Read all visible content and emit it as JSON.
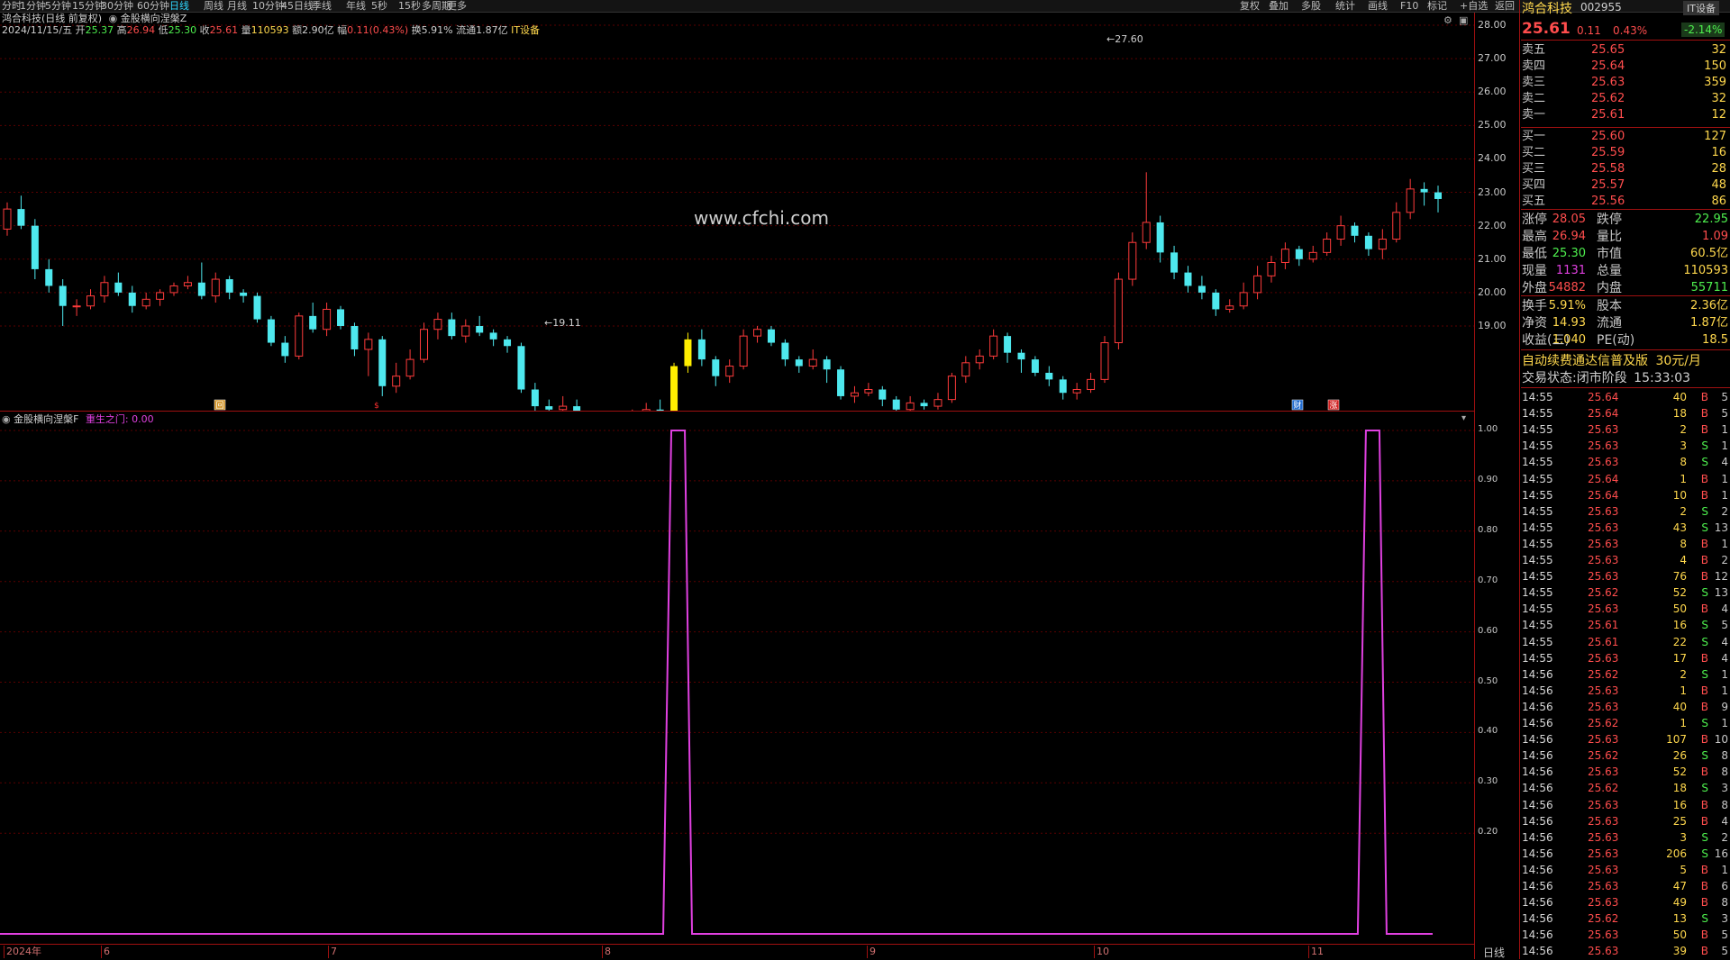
{
  "toolbar": {
    "periods": [
      "分时",
      "1分钟",
      "5分钟",
      "15分钟",
      "30分钟",
      "60分钟",
      "日线",
      "周线",
      "月线",
      "10分钟",
      "45日线",
      "季线",
      "年线",
      "5秒",
      "15秒",
      "多周期",
      "更多"
    ],
    "active_period": "日线",
    "right_items": [
      "复权",
      "叠加",
      "多股",
      "统计",
      "画线",
      "F10",
      "标记",
      "+自选",
      "返回"
    ]
  },
  "chart": {
    "stock_line": "鸿合科技(日线 前复权)",
    "formula_name": "金股横向涅槃Z",
    "info": {
      "date": "2024/11/15/五",
      "open_label": "开",
      "open": "25.37",
      "high_label": "高",
      "high": "26.94",
      "low_label": "低",
      "low": "25.30",
      "close_label": "收",
      "close": "25.61",
      "vol_label": "量",
      "vol": "110593",
      "amount_label": "额",
      "amount": "2.90亿",
      "change_label": "幅",
      "change": "0.11(0.43%)",
      "turnover": "换5.91%",
      "float": "流通1.87亿",
      "sector": "IT设备"
    },
    "y_labels": [
      "28.00",
      "27.00",
      "26.00",
      "25.00",
      "24.00",
      "23.00",
      "22.00",
      "21.00",
      "20.00",
      "19.00"
    ],
    "max_label": "27.60",
    "min_label": "19.11",
    "watermark": "www.cfchi.com",
    "markers": [
      "回",
      "$",
      "财",
      "涨"
    ]
  },
  "indicator": {
    "name": "金股横向涅槃F",
    "line_label": "重生之门:",
    "line_value": "0.00",
    "y_labels": [
      "1.00",
      "0.90",
      "0.80",
      "0.70",
      "0.60",
      "0.50",
      "0.40",
      "0.30",
      "0.20"
    ]
  },
  "x_axis": [
    "2024年",
    "6",
    "7",
    "8",
    "9",
    "10",
    "11"
  ],
  "bottom_label": "日线",
  "panel": {
    "name": "鸿合科技",
    "code": "002955",
    "sector": "IT设备",
    "price": "25.61",
    "change": "0.11",
    "pct": "0.43%",
    "sector_pct": "-2.14%",
    "asks": [
      {
        "label": "卖五",
        "price": "25.65",
        "vol": "32"
      },
      {
        "label": "卖四",
        "price": "25.64",
        "vol": "150"
      },
      {
        "label": "卖三",
        "price": "25.63",
        "vol": "359"
      },
      {
        "label": "卖二",
        "price": "25.62",
        "vol": "32"
      },
      {
        "label": "卖一",
        "price": "25.61",
        "vol": "12"
      }
    ],
    "bids": [
      {
        "label": "买一",
        "price": "25.60",
        "vol": "127"
      },
      {
        "label": "买二",
        "price": "25.59",
        "vol": "16"
      },
      {
        "label": "买三",
        "price": "25.58",
        "vol": "28"
      },
      {
        "label": "买四",
        "price": "25.57",
        "vol": "48"
      },
      {
        "label": "买五",
        "price": "25.56",
        "vol": "86"
      }
    ],
    "stats": [
      {
        "l1": "涨停",
        "v1": "28.05",
        "l2": "跌停",
        "v2": "22.95"
      },
      {
        "l1": "最高",
        "v1": "26.94",
        "l2": "量比",
        "v2": "1.09"
      },
      {
        "l1": "最低",
        "v1": "25.30",
        "l2": "市值",
        "v2": "60.5亿"
      },
      {
        "l1": "现量",
        "v1": "1131",
        "l2": "总量",
        "v2": "110593"
      },
      {
        "l1": "外盘",
        "v1": "54882",
        "l2": "内盘",
        "v2": "55711"
      }
    ],
    "stats2": [
      {
        "l1": "换手",
        "v1": "5.91%",
        "l2": "股本",
        "v2": "2.36亿"
      },
      {
        "l1": "净资",
        "v1": "14.93",
        "l2": "流通",
        "v2": "1.87亿"
      },
      {
        "l1": "收益(三)",
        "v1": "1.040",
        "l2": "PE(动)",
        "v2": "18.5"
      }
    ],
    "ad": "自动续费通达信普及版",
    "ad_price": "30元/月",
    "trade_status_label": "交易状态:",
    "trade_status": "闭市阶段",
    "trade_time": "15:33:03",
    "ticks": [
      {
        "t": "14:55",
        "p": "25.64",
        "v": "40",
        "d": "B",
        "n": "5"
      },
      {
        "t": "14:55",
        "p": "25.64",
        "v": "18",
        "d": "B",
        "n": "5"
      },
      {
        "t": "14:55",
        "p": "25.63",
        "v": "2",
        "d": "B",
        "n": "1"
      },
      {
        "t": "14:55",
        "p": "25.63",
        "v": "3",
        "d": "S",
        "n": "1"
      },
      {
        "t": "14:55",
        "p": "25.63",
        "v": "8",
        "d": "S",
        "n": "4"
      },
      {
        "t": "14:55",
        "p": "25.64",
        "v": "1",
        "d": "B",
        "n": "1"
      },
      {
        "t": "14:55",
        "p": "25.64",
        "v": "10",
        "d": "B",
        "n": "1"
      },
      {
        "t": "14:55",
        "p": "25.63",
        "v": "2",
        "d": "S",
        "n": "2"
      },
      {
        "t": "14:55",
        "p": "25.63",
        "v": "43",
        "d": "S",
        "n": "13"
      },
      {
        "t": "14:55",
        "p": "25.63",
        "v": "8",
        "d": "B",
        "n": "1"
      },
      {
        "t": "14:55",
        "p": "25.63",
        "v": "4",
        "d": "B",
        "n": "2"
      },
      {
        "t": "14:55",
        "p": "25.63",
        "v": "76",
        "d": "B",
        "n": "12"
      },
      {
        "t": "14:55",
        "p": "25.62",
        "v": "52",
        "d": "S",
        "n": "13"
      },
      {
        "t": "14:55",
        "p": "25.63",
        "v": "50",
        "d": "B",
        "n": "4"
      },
      {
        "t": "14:55",
        "p": "25.61",
        "v": "16",
        "d": "S",
        "n": "5"
      },
      {
        "t": "14:55",
        "p": "25.61",
        "v": "22",
        "d": "S",
        "n": "4"
      },
      {
        "t": "14:55",
        "p": "25.63",
        "v": "17",
        "d": "B",
        "n": "4"
      },
      {
        "t": "14:56",
        "p": "25.62",
        "v": "2",
        "d": "S",
        "n": "1"
      },
      {
        "t": "14:56",
        "p": "25.63",
        "v": "1",
        "d": "B",
        "n": "1"
      },
      {
        "t": "14:56",
        "p": "25.63",
        "v": "40",
        "d": "B",
        "n": "9"
      },
      {
        "t": "14:56",
        "p": "25.62",
        "v": "1",
        "d": "S",
        "n": "1"
      },
      {
        "t": "14:56",
        "p": "25.63",
        "v": "107",
        "d": "B",
        "n": "10"
      },
      {
        "t": "14:56",
        "p": "25.62",
        "v": "26",
        "d": "S",
        "n": "8"
      },
      {
        "t": "14:56",
        "p": "25.63",
        "v": "52",
        "d": "B",
        "n": "8"
      },
      {
        "t": "14:56",
        "p": "25.62",
        "v": "18",
        "d": "S",
        "n": "3"
      },
      {
        "t": "14:56",
        "p": "25.63",
        "v": "16",
        "d": "B",
        "n": "8"
      },
      {
        "t": "14:56",
        "p": "25.63",
        "v": "25",
        "d": "B",
        "n": "4"
      },
      {
        "t": "14:56",
        "p": "25.63",
        "v": "3",
        "d": "S",
        "n": "2"
      },
      {
        "t": "14:56",
        "p": "25.63",
        "v": "206",
        "d": "S",
        "n": "16"
      },
      {
        "t": "14:56",
        "p": "25.63",
        "v": "5",
        "d": "B",
        "n": "1"
      },
      {
        "t": "14:56",
        "p": "25.63",
        "v": "47",
        "d": "B",
        "n": "6"
      },
      {
        "t": "14:56",
        "p": "25.63",
        "v": "49",
        "d": "B",
        "n": "8"
      },
      {
        "t": "14:56",
        "p": "25.62",
        "v": "13",
        "d": "S",
        "n": "3"
      },
      {
        "t": "14:56",
        "p": "25.63",
        "v": "50",
        "d": "B",
        "n": "5"
      },
      {
        "t": "14:56",
        "p": "25.63",
        "v": "39",
        "d": "B",
        "n": "5"
      }
    ]
  },
  "colors": {
    "up": "#ff3b3b",
    "down": "#4ee8ee",
    "signal": "#ffee00",
    "indicator": "#e040e0",
    "grid": "#5a0000"
  },
  "chart_data": {
    "type": "candlestick",
    "price_range": [
      19,
      28
    ],
    "indicator_range": [
      0,
      1
    ],
    "indicator_signals": [
      {
        "from": "2024-07-31",
        "to": "2024-08-01",
        "value": 1
      },
      {
        "from": "2024-11-06",
        "to": "2024-11-07",
        "value": 1
      }
    ],
    "candles": [
      {
        "o": 21.9,
        "c": 22.5,
        "h": 22.7,
        "l": 21.7
      },
      {
        "o": 22.5,
        "c": 22.0,
        "h": 22.9,
        "l": 21.9
      },
      {
        "o": 22.0,
        "c": 20.7,
        "h": 22.2,
        "l": 20.4
      },
      {
        "o": 20.7,
        "c": 20.2,
        "h": 21.0,
        "l": 20.0
      },
      {
        "o": 20.2,
        "c": 19.6,
        "h": 20.4,
        "l": 19.0
      },
      {
        "o": 19.6,
        "c": 19.6,
        "h": 19.8,
        "l": 19.3
      },
      {
        "o": 19.6,
        "c": 19.9,
        "h": 20.1,
        "l": 19.5
      },
      {
        "o": 19.9,
        "c": 20.3,
        "h": 20.5,
        "l": 19.7
      },
      {
        "o": 20.3,
        "c": 20.0,
        "h": 20.6,
        "l": 19.9
      },
      {
        "o": 20.0,
        "c": 19.6,
        "h": 20.2,
        "l": 19.4
      },
      {
        "o": 19.6,
        "c": 19.8,
        "h": 20.0,
        "l": 19.5
      },
      {
        "o": 19.8,
        "c": 20.0,
        "h": 20.1,
        "l": 19.6
      },
      {
        "o": 20.0,
        "c": 20.2,
        "h": 20.3,
        "l": 19.9
      },
      {
        "o": 20.2,
        "c": 20.3,
        "h": 20.5,
        "l": 20.1
      },
      {
        "o": 20.3,
        "c": 19.9,
        "h": 20.9,
        "l": 19.8
      },
      {
        "o": 19.9,
        "c": 20.4,
        "h": 20.6,
        "l": 19.7
      },
      {
        "o": 20.4,
        "c": 20.0,
        "h": 20.5,
        "l": 19.8
      },
      {
        "o": 20.0,
        "c": 19.9,
        "h": 20.1,
        "l": 19.7
      },
      {
        "o": 19.9,
        "c": 19.2,
        "h": 20.0,
        "l": 19.1
      },
      {
        "o": 19.2,
        "c": 18.5,
        "h": 19.3,
        "l": 18.4
      },
      {
        "o": 18.5,
        "c": 18.1,
        "h": 18.7,
        "l": 17.9
      },
      {
        "o": 18.1,
        "c": 19.3,
        "h": 19.4,
        "l": 18.0
      },
      {
        "o": 19.3,
        "c": 18.9,
        "h": 19.7,
        "l": 18.8
      },
      {
        "o": 18.9,
        "c": 19.5,
        "h": 19.7,
        "l": 18.7
      },
      {
        "o": 19.5,
        "c": 19.0,
        "h": 19.6,
        "l": 18.9
      },
      {
        "o": 19.0,
        "c": 18.3,
        "h": 19.1,
        "l": 18.1
      },
      {
        "o": 18.3,
        "c": 18.6,
        "h": 18.8,
        "l": 17.5
      },
      {
        "o": 18.6,
        "c": 17.2,
        "h": 18.7,
        "l": 16.9
      },
      {
        "o": 17.2,
        "c": 17.5,
        "h": 17.9,
        "l": 17.0
      },
      {
        "o": 17.5,
        "c": 18.0,
        "h": 18.3,
        "l": 17.4
      },
      {
        "o": 18.0,
        "c": 18.9,
        "h": 19.1,
        "l": 17.9
      },
      {
        "o": 18.9,
        "c": 19.2,
        "h": 19.4,
        "l": 18.6
      },
      {
        "o": 19.2,
        "c": 18.7,
        "h": 19.4,
        "l": 18.6
      },
      {
        "o": 18.7,
        "c": 19.0,
        "h": 19.2,
        "l": 18.5
      },
      {
        "o": 19.0,
        "c": 18.8,
        "h": 19.3,
        "l": 18.7
      },
      {
        "o": 18.8,
        "c": 18.6,
        "h": 18.9,
        "l": 18.4
      },
      {
        "o": 18.6,
        "c": 18.4,
        "h": 18.7,
        "l": 18.2
      },
      {
        "o": 18.4,
        "c": 17.1,
        "h": 18.5,
        "l": 17.0
      },
      {
        "o": 17.1,
        "c": 16.6,
        "h": 17.3,
        "l": 16.4
      },
      {
        "o": 16.6,
        "c": 16.5,
        "h": 16.8,
        "l": 16.3
      },
      {
        "o": 16.5,
        "c": 16.6,
        "h": 16.9,
        "l": 16.4
      },
      {
        "o": 16.6,
        "c": 16.3,
        "h": 16.8,
        "l": 16.1
      },
      {
        "o": 16.3,
        "c": 15.9,
        "h": 16.4,
        "l": 15.7
      },
      {
        "o": 15.9,
        "c": 15.7,
        "h": 16.0,
        "l": 15.5
      },
      {
        "o": 15.7,
        "c": 15.5,
        "h": 15.9,
        "l": 15.3
      },
      {
        "o": 15.5,
        "c": 16.3,
        "h": 16.5,
        "l": 15.4
      },
      {
        "o": 16.3,
        "c": 16.5,
        "h": 16.7,
        "l": 16.1
      },
      {
        "o": 16.5,
        "c": 16.0,
        "h": 16.8,
        "l": 15.8
      },
      {
        "o": 16.0,
        "c": 17.8,
        "h": 17.9,
        "l": 15.9
      },
      {
        "o": 17.8,
        "c": 18.6,
        "h": 18.8,
        "l": 17.6
      },
      {
        "o": 18.6,
        "c": 18.0,
        "h": 18.9,
        "l": 17.8
      },
      {
        "o": 18.0,
        "c": 17.5,
        "h": 18.1,
        "l": 17.2
      },
      {
        "o": 17.5,
        "c": 17.8,
        "h": 18.0,
        "l": 17.3
      },
      {
        "o": 17.8,
        "c": 18.7,
        "h": 18.9,
        "l": 17.7
      },
      {
        "o": 18.7,
        "c": 18.9,
        "h": 19.0,
        "l": 18.5
      },
      {
        "o": 18.9,
        "c": 18.5,
        "h": 19.0,
        "l": 18.4
      },
      {
        "o": 18.5,
        "c": 18.0,
        "h": 18.6,
        "l": 17.8
      },
      {
        "o": 18.0,
        "c": 17.8,
        "h": 18.1,
        "l": 17.6
      },
      {
        "o": 17.8,
        "c": 18.0,
        "h": 18.3,
        "l": 17.7
      },
      {
        "o": 18.0,
        "c": 17.7,
        "h": 18.1,
        "l": 17.3
      },
      {
        "o": 17.7,
        "c": 16.9,
        "h": 17.8,
        "l": 16.8
      },
      {
        "o": 16.9,
        "c": 17.0,
        "h": 17.2,
        "l": 16.7
      },
      {
        "o": 17.0,
        "c": 17.1,
        "h": 17.3,
        "l": 16.9
      },
      {
        "o": 17.1,
        "c": 16.8,
        "h": 17.2,
        "l": 16.6
      },
      {
        "o": 16.8,
        "c": 16.5,
        "h": 16.9,
        "l": 16.3
      },
      {
        "o": 16.5,
        "c": 16.7,
        "h": 16.9,
        "l": 16.4
      },
      {
        "o": 16.7,
        "c": 16.6,
        "h": 16.8,
        "l": 16.5
      },
      {
        "o": 16.6,
        "c": 16.8,
        "h": 17.0,
        "l": 16.5
      },
      {
        "o": 16.8,
        "c": 17.5,
        "h": 17.6,
        "l": 16.7
      },
      {
        "o": 17.5,
        "c": 17.9,
        "h": 18.1,
        "l": 17.3
      },
      {
        "o": 17.9,
        "c": 18.1,
        "h": 18.3,
        "l": 17.7
      },
      {
        "o": 18.1,
        "c": 18.7,
        "h": 18.9,
        "l": 18.0
      },
      {
        "o": 18.7,
        "c": 18.2,
        "h": 18.8,
        "l": 17.9
      },
      {
        "o": 18.2,
        "c": 18.0,
        "h": 18.3,
        "l": 17.6
      },
      {
        "o": 18.0,
        "c": 17.6,
        "h": 18.1,
        "l": 17.5
      },
      {
        "o": 17.6,
        "c": 17.4,
        "h": 17.8,
        "l": 17.2
      },
      {
        "o": 17.4,
        "c": 17.0,
        "h": 17.5,
        "l": 16.8
      },
      {
        "o": 17.0,
        "c": 17.1,
        "h": 17.3,
        "l": 16.8
      },
      {
        "o": 17.1,
        "c": 17.4,
        "h": 17.6,
        "l": 17.0
      },
      {
        "o": 17.4,
        "c": 18.5,
        "h": 18.7,
        "l": 17.3
      },
      {
        "o": 18.5,
        "c": 20.4,
        "h": 20.6,
        "l": 18.3
      },
      {
        "o": 20.4,
        "c": 21.5,
        "h": 21.8,
        "l": 20.2
      },
      {
        "o": 21.5,
        "c": 22.1,
        "h": 23.6,
        "l": 21.3
      },
      {
        "o": 22.1,
        "c": 21.2,
        "h": 22.3,
        "l": 20.9
      },
      {
        "o": 21.2,
        "c": 20.6,
        "h": 21.4,
        "l": 20.4
      },
      {
        "o": 20.6,
        "c": 20.2,
        "h": 20.8,
        "l": 20.0
      },
      {
        "o": 20.2,
        "c": 20.0,
        "h": 20.5,
        "l": 19.8
      },
      {
        "o": 20.0,
        "c": 19.5,
        "h": 20.1,
        "l": 19.3
      },
      {
        "o": 19.5,
        "c": 19.6,
        "h": 19.8,
        "l": 19.4
      },
      {
        "o": 19.6,
        "c": 20.0,
        "h": 20.3,
        "l": 19.5
      },
      {
        "o": 20.0,
        "c": 20.5,
        "h": 20.8,
        "l": 19.8
      },
      {
        "o": 20.5,
        "c": 20.9,
        "h": 21.1,
        "l": 20.3
      },
      {
        "o": 20.9,
        "c": 21.3,
        "h": 21.5,
        "l": 20.7
      },
      {
        "o": 21.3,
        "c": 21.0,
        "h": 21.4,
        "l": 20.8
      },
      {
        "o": 21.0,
        "c": 21.2,
        "h": 21.4,
        "l": 20.9
      },
      {
        "o": 21.2,
        "c": 21.6,
        "h": 21.8,
        "l": 21.1
      },
      {
        "o": 21.6,
        "c": 22.0,
        "h": 22.3,
        "l": 21.4
      },
      {
        "o": 22.0,
        "c": 21.7,
        "h": 22.1,
        "l": 21.5
      },
      {
        "o": 21.7,
        "c": 21.3,
        "h": 21.8,
        "l": 21.1
      },
      {
        "o": 21.3,
        "c": 21.6,
        "h": 21.9,
        "l": 21.0
      },
      {
        "o": 21.6,
        "c": 22.4,
        "h": 22.7,
        "l": 21.5
      },
      {
        "o": 22.4,
        "c": 23.1,
        "h": 23.4,
        "l": 22.2
      },
      {
        "o": 23.1,
        "c": 23.0,
        "h": 23.3,
        "l": 22.6
      },
      {
        "o": 23.0,
        "c": 22.8,
        "h": 23.2,
        "l": 22.4
      }
    ]
  }
}
